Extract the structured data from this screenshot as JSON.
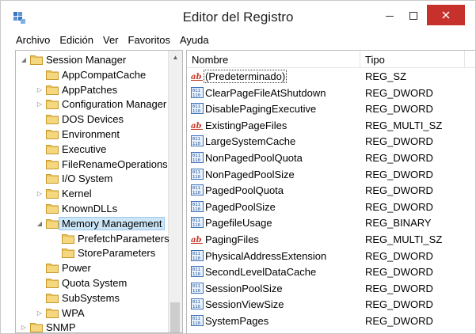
{
  "window": {
    "title": "Editor del Registro"
  },
  "menubar": [
    "Archivo",
    "Edición",
    "Ver",
    "Favoritos",
    "Ayuda"
  ],
  "tree": {
    "items": [
      {
        "label": "Session Manager",
        "level": 0,
        "expander": "expanded"
      },
      {
        "label": "AppCompatCache",
        "level": 1,
        "expander": "none"
      },
      {
        "label": "AppPatches",
        "level": 1,
        "expander": "collapsed"
      },
      {
        "label": "Configuration Manager",
        "level": 1,
        "expander": "collapsed"
      },
      {
        "label": "DOS Devices",
        "level": 1,
        "expander": "none"
      },
      {
        "label": "Environment",
        "level": 1,
        "expander": "none"
      },
      {
        "label": "Executive",
        "level": 1,
        "expander": "none"
      },
      {
        "label": "FileRenameOperations",
        "level": 1,
        "expander": "none"
      },
      {
        "label": "I/O System",
        "level": 1,
        "expander": "none"
      },
      {
        "label": "Kernel",
        "level": 1,
        "expander": "collapsed"
      },
      {
        "label": "KnownDLLs",
        "level": 1,
        "expander": "none"
      },
      {
        "label": "Memory Management",
        "level": 1,
        "expander": "expanded",
        "selected": true
      },
      {
        "label": "PrefetchParameters",
        "level": 2,
        "expander": "none"
      },
      {
        "label": "StoreParameters",
        "level": 2,
        "expander": "none"
      },
      {
        "label": "Power",
        "level": 1,
        "expander": "none"
      },
      {
        "label": "Quota System",
        "level": 1,
        "expander": "none"
      },
      {
        "label": "SubSystems",
        "level": 1,
        "expander": "none"
      },
      {
        "label": "WPA",
        "level": 1,
        "expander": "collapsed"
      },
      {
        "label": "SNMP",
        "level": 0,
        "expander": "collapsed"
      }
    ]
  },
  "list": {
    "columns": {
      "name": "Nombre",
      "type": "Tipo"
    },
    "rows": [
      {
        "name": "(Predeterminado)",
        "type": "REG_SZ",
        "icon": "string-value-icon",
        "focused": true
      },
      {
        "name": "ClearPageFileAtShutdown",
        "type": "REG_DWORD",
        "icon": "binary-value-icon"
      },
      {
        "name": "DisablePagingExecutive",
        "type": "REG_DWORD",
        "icon": "binary-value-icon"
      },
      {
        "name": "ExistingPageFiles",
        "type": "REG_MULTI_SZ",
        "icon": "string-value-icon"
      },
      {
        "name": "LargeSystemCache",
        "type": "REG_DWORD",
        "icon": "binary-value-icon"
      },
      {
        "name": "NonPagedPoolQuota",
        "type": "REG_DWORD",
        "icon": "binary-value-icon"
      },
      {
        "name": "NonPagedPoolSize",
        "type": "REG_DWORD",
        "icon": "binary-value-icon"
      },
      {
        "name": "PagedPoolQuota",
        "type": "REG_DWORD",
        "icon": "binary-value-icon"
      },
      {
        "name": "PagedPoolSize",
        "type": "REG_DWORD",
        "icon": "binary-value-icon"
      },
      {
        "name": "PagefileUsage",
        "type": "REG_BINARY",
        "icon": "binary-value-icon"
      },
      {
        "name": "PagingFiles",
        "type": "REG_MULTI_SZ",
        "icon": "string-value-icon"
      },
      {
        "name": "PhysicalAddressExtension",
        "type": "REG_DWORD",
        "icon": "binary-value-icon"
      },
      {
        "name": "SecondLevelDataCache",
        "type": "REG_DWORD",
        "icon": "binary-value-icon"
      },
      {
        "name": "SessionPoolSize",
        "type": "REG_DWORD",
        "icon": "binary-value-icon"
      },
      {
        "name": "SessionViewSize",
        "type": "REG_DWORD",
        "icon": "binary-value-icon"
      },
      {
        "name": "SystemPages",
        "type": "REG_DWORD",
        "icon": "binary-value-icon"
      }
    ]
  },
  "colors": {
    "close_button": "#c7312b",
    "selection": "#cde6f7",
    "folder": "#e8c35a"
  }
}
